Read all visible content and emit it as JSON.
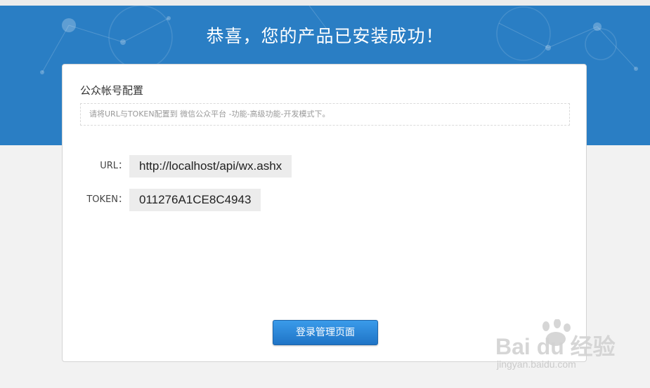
{
  "banner": {
    "title": "恭喜，您的产品已安装成功！",
    "background_color": "#2a7ec4"
  },
  "config": {
    "title": "公众帐号配置",
    "hint": "请将URL与TOKEN配置到 微信公众平台 -功能-高级功能-开发模式下。",
    "fields": [
      {
        "label": "URL：",
        "value": "http://localhost/api/wx.ashx"
      },
      {
        "label": "TOKEN：",
        "value": "011276A1CE8C4943"
      }
    ]
  },
  "actions": {
    "login_label": "登录管理页面",
    "button_color": "#1f74c6"
  },
  "watermark": {
    "logo_text": "Bai du 经验",
    "url_text": "jingyan.baidu.com"
  }
}
